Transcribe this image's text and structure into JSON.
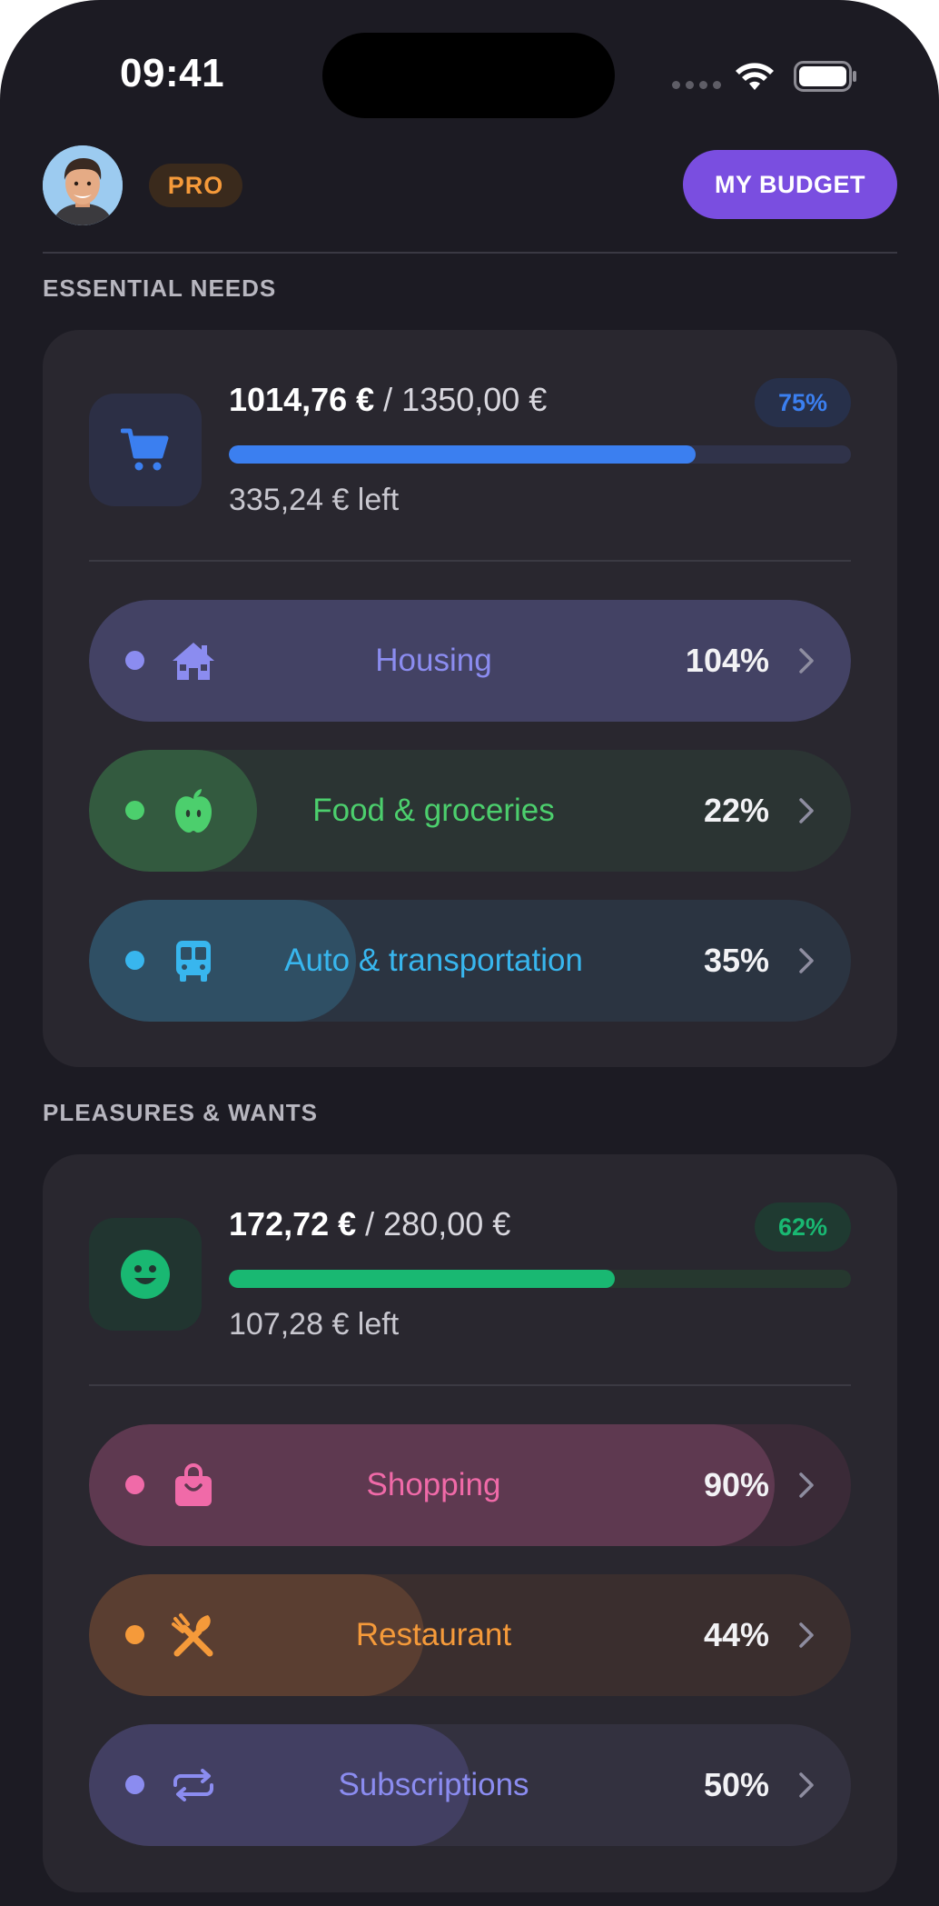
{
  "status_bar": {
    "time": "09:41"
  },
  "header": {
    "pro_label": "PRO",
    "budget_button": "MY BUDGET"
  },
  "colors": {
    "background": "#1c1b23",
    "card": "#29272f",
    "accent_purple": "#7a4ee0",
    "pro_orange": "#f59a3a",
    "progress_blue": "#3b7ff0",
    "progress_green": "#19b872"
  },
  "essential": {
    "title": "ESSENTIAL NEEDS",
    "spent": "1014,76 €",
    "slash": " / ",
    "total": "1350,00 €",
    "percent": "75%",
    "progress": 0.75,
    "left": "335,24 € left",
    "icon": "cart-icon",
    "categories": [
      {
        "label": "Housing",
        "percent": "104%",
        "progress": 1.04,
        "icon": "house-icon",
        "color": "#8b8cf0"
      },
      {
        "label": "Food & groceries",
        "percent": "22%",
        "progress": 0.22,
        "icon": "apple-icon",
        "color": "#4ccf6d"
      },
      {
        "label": "Auto & transportation",
        "percent": "35%",
        "progress": 0.35,
        "icon": "bus-icon",
        "color": "#38b6ee"
      }
    ]
  },
  "pleasures": {
    "title": "PLEASURES & WANTS",
    "spent": "172,72 €",
    "slash": " / ",
    "total": "280,00 €",
    "percent": "62%",
    "progress": 0.62,
    "left": "107,28 € left",
    "icon": "smiley-icon",
    "categories": [
      {
        "label": "Shopping",
        "percent": "90%",
        "progress": 0.9,
        "icon": "shopping-bag-icon",
        "color": "#f06aa8"
      },
      {
        "label": "Restaurant",
        "percent": "44%",
        "progress": 0.44,
        "icon": "utensils-icon",
        "color": "#f59a3a"
      },
      {
        "label": "Subscriptions",
        "percent": "50%",
        "progress": 0.5,
        "icon": "repeat-icon",
        "color": "#8b8cf0"
      }
    ]
  }
}
